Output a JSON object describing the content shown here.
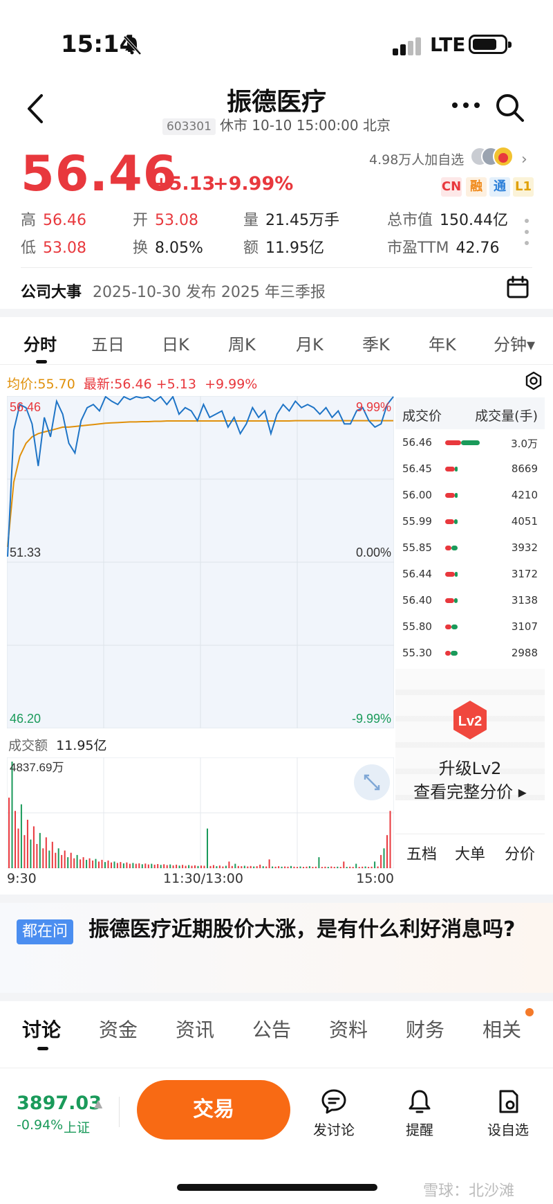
{
  "status": {
    "time": "15:14",
    "network": "LTE"
  },
  "header": {
    "title": "振德医疗",
    "code": "603301",
    "status_line": "休市 10-10 15:00:00 北京"
  },
  "quote": {
    "price": "56.46",
    "change": "+5.13",
    "change_pct": "+9.99%",
    "followers": "4.98万人加自选",
    "tags": [
      "CN",
      "融",
      "通",
      "L1"
    ],
    "stats": {
      "high_k": "高",
      "high_v": "56.46",
      "open_k": "开",
      "open_v": "53.08",
      "volume_k": "量",
      "volume_v": "21.45万手",
      "mcap_k": "总市值",
      "mcap_v": "150.44亿",
      "low_k": "低",
      "low_v": "53.08",
      "turnover_k": "换",
      "turnover_v": "8.05%",
      "amount_k": "额",
      "amount_v": "11.95亿",
      "pe_k": "市盈TTM",
      "pe_v": "42.76"
    }
  },
  "event": {
    "label": "公司大事",
    "text": "2025-10-30 发布 2025 年三季报"
  },
  "chart_tabs": [
    "分时",
    "五日",
    "日K",
    "周K",
    "月K",
    "季K",
    "年K",
    "分钟▾"
  ],
  "chart_header": {
    "avg": "均价:55.70",
    "latest": "最新:56.46",
    "change": "+5.13",
    "pct": "+9.99%"
  },
  "chart_labels": {
    "top_left": "56.46",
    "top_right": "9.99%",
    "mid_left": "51.33",
    "mid_right": "0.00%",
    "bot_left": "46.20",
    "bot_right": "-9.99%",
    "volume_title": "成交额",
    "volume_total": "11.95亿",
    "volume_max": "4837.69万",
    "x_start": "9:30",
    "x_mid": "11:30/13:00",
    "x_end": "15:00"
  },
  "chart_data": {
    "type": "line",
    "title": "",
    "ylim": [
      46.2,
      56.46
    ],
    "y_ticks": [
      "56.46",
      "51.33",
      "46.20"
    ],
    "pct_ticks": [
      "9.99%",
      "0.00%",
      "-9.99%"
    ],
    "x_ticks": [
      "9:30",
      "11:30/13:00",
      "15:00"
    ],
    "series": [
      {
        "name": "最新",
        "values": [
          51.5,
          55.4,
          56.2,
          56.1,
          55.6,
          54.3,
          55.8,
          55.2,
          56.3,
          55.9,
          55.0,
          54.7,
          55.7,
          56.1,
          56.2,
          56.0,
          56.46,
          56.3,
          56.2,
          56.46,
          56.35,
          56.46,
          56.4,
          56.46,
          56.3,
          56.46,
          56.2,
          56.46,
          55.9,
          56.1,
          56.0,
          55.7,
          56.2,
          55.8,
          55.9,
          56.0,
          55.5,
          55.8,
          55.3,
          55.6,
          56.1,
          55.8,
          56.0,
          55.3,
          55.9,
          56.2,
          56.0,
          56.3,
          56.1,
          56.2,
          56.1,
          55.9,
          56.1,
          55.8,
          56.0,
          55.6,
          55.6,
          56.0,
          56.1,
          55.7,
          55.5,
          55.6,
          56.2,
          56.46
        ]
      },
      {
        "name": "均价",
        "values": [
          51.8,
          53.8,
          54.6,
          55.0,
          55.2,
          55.3,
          55.35,
          55.4,
          55.45,
          55.5,
          55.5,
          55.52,
          55.54,
          55.56,
          55.58,
          55.6,
          55.62,
          55.63,
          55.64,
          55.65,
          55.66,
          55.66,
          55.67,
          55.67,
          55.68,
          55.68,
          55.69,
          55.69,
          55.69,
          55.69,
          55.69,
          55.69,
          55.69,
          55.69,
          55.69,
          55.69,
          55.69,
          55.69,
          55.69,
          55.69,
          55.69,
          55.69,
          55.69,
          55.69,
          55.69,
          55.69,
          55.69,
          55.7,
          55.7,
          55.7,
          55.7,
          55.7,
          55.7,
          55.7,
          55.7,
          55.7,
          55.7,
          55.7,
          55.7,
          55.7,
          55.7,
          55.7,
          55.7,
          55.7
        ]
      }
    ],
    "volume": {
      "ymax": 4837.69,
      "unit": "万",
      "values": [
        3200,
        4837,
        2600,
        1800,
        2900,
        1500,
        2200,
        1300,
        1900,
        1100,
        1600,
        900,
        1400,
        800,
        1200,
        700,
        900,
        600,
        800,
        500,
        700,
        450,
        600,
        400,
        500,
        380,
        450,
        350,
        420,
        300,
        380,
        280,
        350,
        260,
        300,
        240,
        280,
        220,
        260,
        200,
        240,
        200,
        220,
        180,
        210,
        170,
        200,
        160,
        190,
        150,
        180,
        140,
        170,
        130,
        160,
        120,
        150,
        110,
        140,
        110,
        130,
        100,
        120,
        110,
        1800,
        100,
        140,
        90,
        120,
        80,
        110,
        300,
        100,
        200,
        100,
        90,
        110,
        80,
        100,
        80,
        90,
        160,
        90,
        80,
        400,
        80,
        70,
        90,
        70,
        80,
        70,
        100,
        70,
        60,
        80,
        60,
        70,
        90,
        60,
        70,
        500,
        60,
        70,
        60,
        80,
        60,
        70,
        60,
        300,
        60,
        70,
        60,
        200,
        60,
        70,
        80,
        60,
        70,
        300,
        80,
        600,
        900,
        1500,
        2600
      ]
    }
  },
  "orders": {
    "header_price": "成交价",
    "header_vol": "成交量(手)",
    "rows": [
      {
        "price": "56.46",
        "vol": "3.0万",
        "red": 0.45,
        "green": 0.55
      },
      {
        "price": "56.45",
        "vol": "8669",
        "red": 0.75,
        "green": 0.25
      },
      {
        "price": "56.00",
        "vol": "4210",
        "red": 0.75,
        "green": 0.25
      },
      {
        "price": "55.99",
        "vol": "4051",
        "red": 0.7,
        "green": 0.3
      },
      {
        "price": "55.85",
        "vol": "3932",
        "red": 0.5,
        "green": 0.5
      },
      {
        "price": "56.44",
        "vol": "3172",
        "red": 0.75,
        "green": 0.25
      },
      {
        "price": "56.40",
        "vol": "3138",
        "red": 0.7,
        "green": 0.3
      },
      {
        "price": "55.80",
        "vol": "3107",
        "red": 0.5,
        "green": 0.5
      },
      {
        "price": "55.30",
        "vol": "2988",
        "red": 0.45,
        "green": 0.55
      }
    ],
    "lv2_title": "升级Lv2",
    "lv2_sub": "查看完整分价 ▸",
    "lv2_badge": "Lv2",
    "detail_tabs": [
      "五档",
      "大单",
      "分价"
    ]
  },
  "ask": {
    "badge": "都在问",
    "text": "振德医疗近期股价大涨，是有什么利好消息吗?"
  },
  "bottom_tabs": [
    "讨论",
    "资金",
    "资讯",
    "公告",
    "资料",
    "财务",
    "相关"
  ],
  "bottom_bar": {
    "index_value": "3897.03",
    "index_change": "-0.94%",
    "index_name": "上证",
    "trade": "交易",
    "discuss": "发讨论",
    "alert": "提醒",
    "custom": "设自选"
  },
  "watermark": "雪球：北沙滩",
  "colors": {
    "up": "#e8383d",
    "down": "#1a9a5a",
    "accent": "#f86a14",
    "line": "#1e74c6",
    "avg": "#e0900a"
  }
}
